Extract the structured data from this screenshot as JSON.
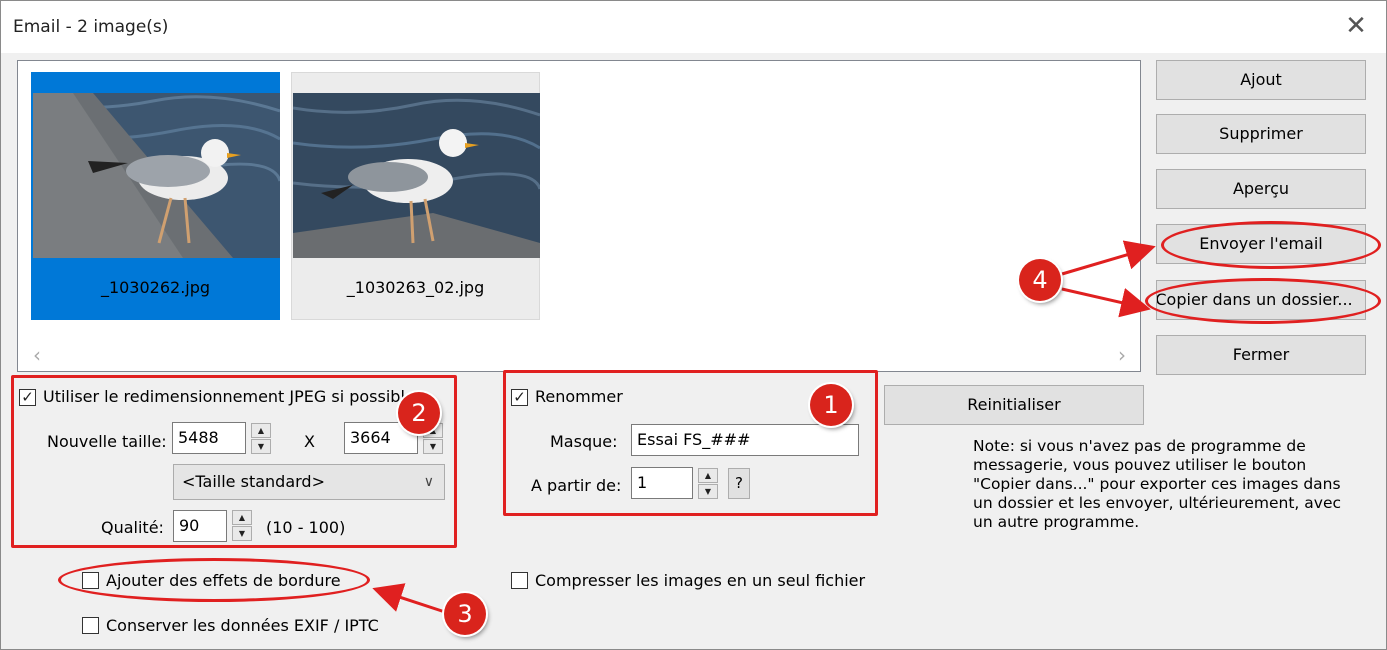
{
  "window": {
    "title": "Email  -  2 image(s)"
  },
  "thumbnails": [
    {
      "filename": "_1030262.jpg",
      "selected": true
    },
    {
      "filename": "_1030263_02.jpg",
      "selected": false
    }
  ],
  "buttons": {
    "ajout": "Ajout",
    "supprimer": "Supprimer",
    "apercu": "Aperçu",
    "envoyer": "Envoyer l'email",
    "copier": "Copier dans un dossier...",
    "fermer": "Fermer",
    "reinitialiser": "Reinitialiser"
  },
  "resize": {
    "checkbox_label": "Utiliser le redimensionnement JPEG si possible",
    "checked": true,
    "size_label": "Nouvelle taille:",
    "width": "5488",
    "x_label": "X",
    "height": "3664",
    "preset": "<Taille standard>",
    "quality_label": "Qualité:",
    "quality": "90",
    "quality_range": "(10 - 100)"
  },
  "rename": {
    "checkbox_label": "Renommer",
    "checked": true,
    "mask_label": "Masque:",
    "mask_value": "Essai FS_###",
    "start_label": "A partir de:",
    "start_value": "1",
    "help": "?"
  },
  "options": {
    "border_effects": "Ajouter des effets de bordure",
    "keep_exif": "Conserver les données EXIF / IPTC",
    "compress": "Compresser les images en un seul fichier"
  },
  "note": "Note: si vous n'avez pas de programme de messagerie, vous pouvez utiliser le bouton \"Copier dans...\" pour exporter ces images dans un dossier et les envoyer, ultérieurement, avec un autre programme.",
  "annotations": {
    "b1": "1",
    "b2": "2",
    "b3": "3",
    "b4": "4"
  },
  "colors": {
    "annotation_red": "#e02020",
    "selection_blue": "#0078d7"
  },
  "icons": [
    "close-icon",
    "spin-up-icon",
    "spin-down-icon",
    "chevron-down-icon",
    "scroll-left-icon",
    "scroll-right-icon",
    "checkmark-icon"
  ]
}
